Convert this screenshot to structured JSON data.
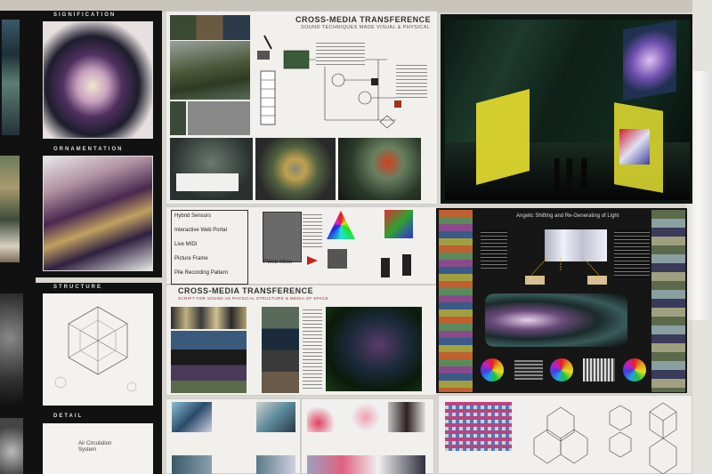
{
  "image_description_text": {
    "poster_title_1": "CROSS-MEDIA TRANSFERENCE",
    "poster_subtitle_1": "SOUND TECHNIQUES MADE VISUAL & PHYSICAL",
    "poster_title_2": "CROSS-MEDIA TRANSFERENCE",
    "poster_subtitle_2": "SCRIPT FOR SOUND AS PHYSICAL STRUCTURE & MEDIA OF SPACE",
    "left_header_1": "SIGNIFICATION",
    "left_header_2": "ORNAMENTATION",
    "left_header_3": "STRUCTURE",
    "left_header_4": "DETAIL",
    "right_panel_title": "Angelic Shifting and Re-Generating of Light",
    "diagram_labels": [
      "Hybrid Sensors",
      "Interactive Web Portal",
      "Live MIDI",
      "Picture Frame",
      "Pile Recording Pattern",
      "PWeb Mixer"
    ],
    "diagram_caption": "Air Circulation System"
  }
}
